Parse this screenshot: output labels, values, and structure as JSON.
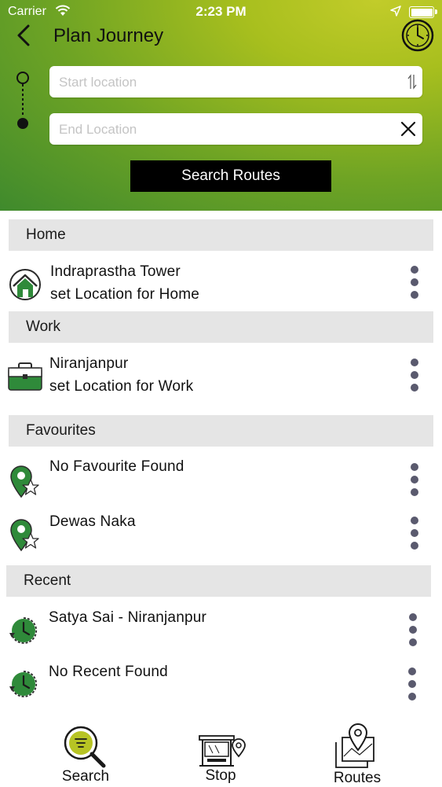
{
  "status_bar": {
    "carrier": "Carrier",
    "time": "2:23 PM"
  },
  "nav": {
    "title": "Plan Journey"
  },
  "search": {
    "start_placeholder": "Start location",
    "end_placeholder": "End Location",
    "search_button": "Search Routes"
  },
  "sections": {
    "home": {
      "header": "Home",
      "item": {
        "title": "Indraprastha Tower",
        "subtitle": "set Location for Home"
      }
    },
    "work": {
      "header": "Work",
      "item": {
        "title": "Niranjanpur",
        "subtitle": "set Location for Work"
      }
    },
    "favourites": {
      "header": "Favourites",
      "items": [
        {
          "title": "No Favourite Found"
        },
        {
          "title": "Dewas Naka"
        }
      ]
    },
    "recent": {
      "header": "Recent",
      "items": [
        {
          "title": "Satya Sai - Niranjanpur"
        },
        {
          "title": "No Recent Found"
        }
      ]
    }
  },
  "tab_bar": {
    "search": "Search",
    "stop": "Stop",
    "routes": "Routes"
  },
  "colors": {
    "brand_green": "#3f8a2d",
    "header_yellow": "#c2cc2a",
    "icon_green": "#2f8a3a"
  },
  "icons": [
    "back-arrow",
    "clock",
    "swap",
    "close",
    "home",
    "briefcase",
    "pin-star",
    "clock-history",
    "search",
    "bus-stop",
    "map-pin"
  ]
}
